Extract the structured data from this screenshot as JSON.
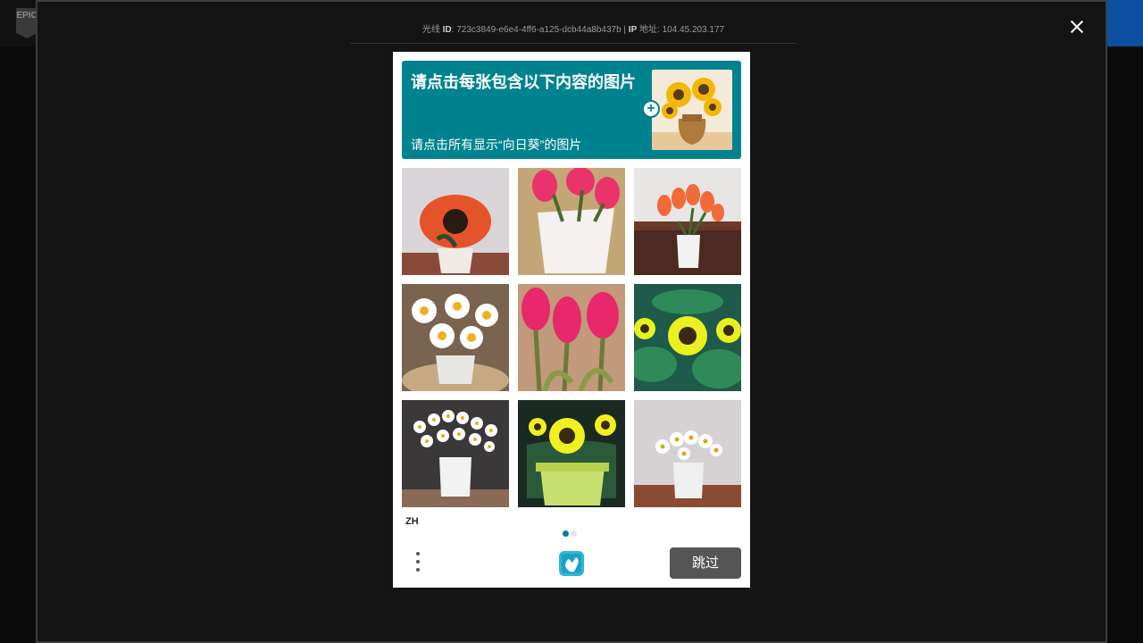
{
  "app": {
    "logo_text": "EPIC"
  },
  "modal": {
    "ray_prefix": "光线",
    "ray_id_label": "ID",
    "ray_id_value": "723c3849-e6e4-4ff6-a125-dcb44a8b437b",
    "ip_label": "IP",
    "ip_suffix": "地址",
    "ip_value": "104.45.203.177"
  },
  "captcha": {
    "prompt_title": "请点击每张包含以下内容的图片",
    "prompt_subtitle": "请点击所有显示“向日葵”的图片",
    "tiles": [
      {
        "label": "sunflower-pot"
      },
      {
        "label": "tulip-vase"
      },
      {
        "label": "tulips-table"
      },
      {
        "label": "daisies-pot"
      },
      {
        "label": "tulips-closeup"
      },
      {
        "label": "sunflowers-field"
      },
      {
        "label": "daisies-white-pot"
      },
      {
        "label": "sunflowers-green-pot"
      },
      {
        "label": "daisies-small-pot"
      }
    ],
    "language": "ZH",
    "skip_label": "跳过",
    "page_indicator": {
      "current": 1,
      "total": 2
    },
    "colors": {
      "accent": "#00838f",
      "button": "#555555"
    }
  }
}
